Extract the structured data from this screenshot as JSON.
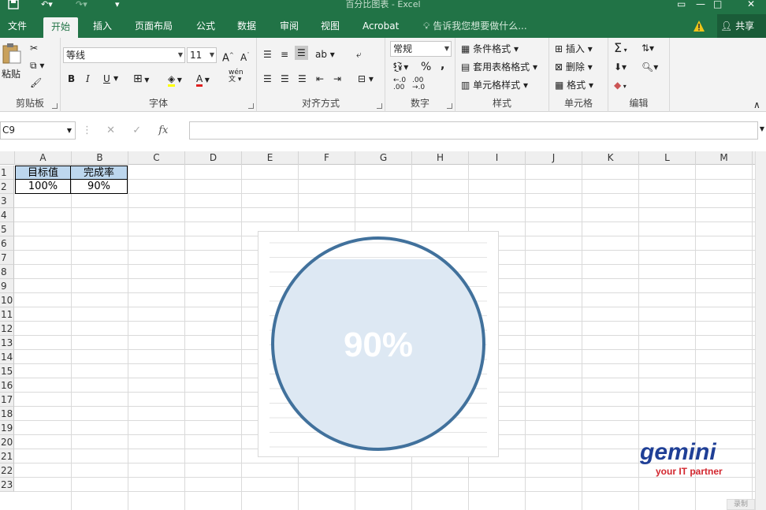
{
  "window": {
    "title": "百分比图表 - Excel"
  },
  "tabs": [
    "文件",
    "开始",
    "插入",
    "页面布局",
    "公式",
    "数据",
    "审阅",
    "视图",
    "Acrobat"
  ],
  "tell_me": "告诉我您想要做什么...",
  "share": "共享",
  "clipboard": {
    "paste": "粘贴",
    "label": "剪贴板"
  },
  "font": {
    "name": "等线",
    "size": "11",
    "label": "字体",
    "bold": "B",
    "italic": "I",
    "underline": "U",
    "color_a": "A",
    "phonetic": "wén"
  },
  "alignment": {
    "label": "对齐方式"
  },
  "number": {
    "format": "常规",
    "label": "数字",
    "percent": "%",
    "comma": ","
  },
  "styles": {
    "conditional": "条件格式",
    "table": "套用表格格式",
    "cell": "单元格样式",
    "label": "样式"
  },
  "cells": {
    "insert": "插入",
    "delete": "删除",
    "format": "格式",
    "label": "单元格"
  },
  "editing": {
    "label": "编辑",
    "sigma": "Σ"
  },
  "formula_bar": {
    "name_box": "C9",
    "value": ""
  },
  "columns": [
    "A",
    "B",
    "C",
    "D",
    "E",
    "F",
    "G",
    "H",
    "I",
    "J",
    "K",
    "L",
    "M"
  ],
  "rows": [
    "1",
    "2",
    "3",
    "4",
    "5",
    "6",
    "7",
    "8",
    "9",
    "10",
    "11",
    "12",
    "13",
    "14",
    "15",
    "16",
    "17",
    "18",
    "19",
    "20",
    "21",
    "22",
    "23"
  ],
  "table": {
    "headers": [
      "目标值",
      "完成率"
    ],
    "values": [
      "100%",
      "90%"
    ]
  },
  "chart_data": {
    "type": "area",
    "title": "",
    "values": [
      0.9
    ],
    "label": "90%",
    "colors": {
      "fill": "#dde8f3",
      "border": "#41719c",
      "label": "#ffffff"
    }
  },
  "logo": {
    "brand": "gemini",
    "tagline": "your IT partner"
  },
  "watermark": "录制"
}
